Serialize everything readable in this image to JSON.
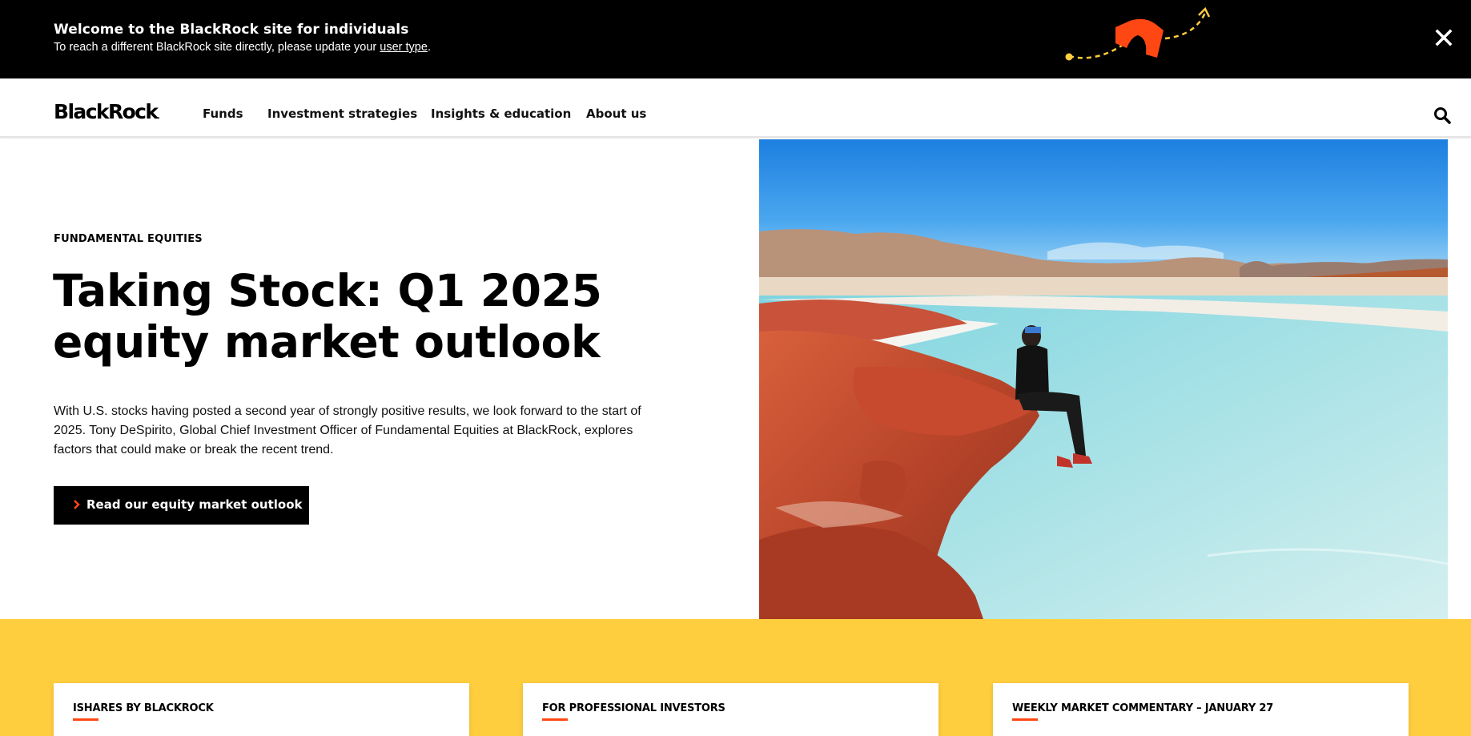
{
  "banner": {
    "title": "Welcome to the BlackRock site for individuals",
    "subtitle_prefix": "To reach a different BlackRock site directly, please update your ",
    "subtitle_link": "user type",
    "subtitle_suffix": ".",
    "close_icon": "close-icon",
    "accent_color": "#ff4713",
    "dash_color": "#ffce3e"
  },
  "nav": {
    "logo": "BlackRock",
    "logo_mark": ".",
    "items": [
      {
        "label": "Funds"
      },
      {
        "label": "Investment strategies"
      },
      {
        "label": "Insights & education"
      },
      {
        "label": "About us"
      }
    ],
    "search_icon": "search-icon"
  },
  "hero": {
    "eyebrow": "FUNDAMENTAL EQUITIES",
    "headline_line1": "Taking Stock: Q1 2025",
    "headline_line2": "equity market outlook",
    "body": "With U.S. stocks having posted a second year of strongly positive results, we look forward to the start of 2025. Tony DeSpirito, Global Chief Investment Officer of Fundamental Equities at BlackRock, explores factors that could make or break the recent trend.",
    "cta_label": "Read our equity market outlook",
    "cta_icon": "chevron-right-icon",
    "image": "person-sitting-on-red-rocks-by-lagoon"
  },
  "cards": [
    {
      "label": "ISHARES BY BLACKROCK"
    },
    {
      "label": "FOR PROFESSIONAL INVESTORS"
    },
    {
      "label": "WEEKLY MARKET COMMENTARY – JANUARY 27"
    }
  ],
  "colors": {
    "black": "#000000",
    "yellow": "#ffce3e",
    "orange": "#ff4713"
  }
}
